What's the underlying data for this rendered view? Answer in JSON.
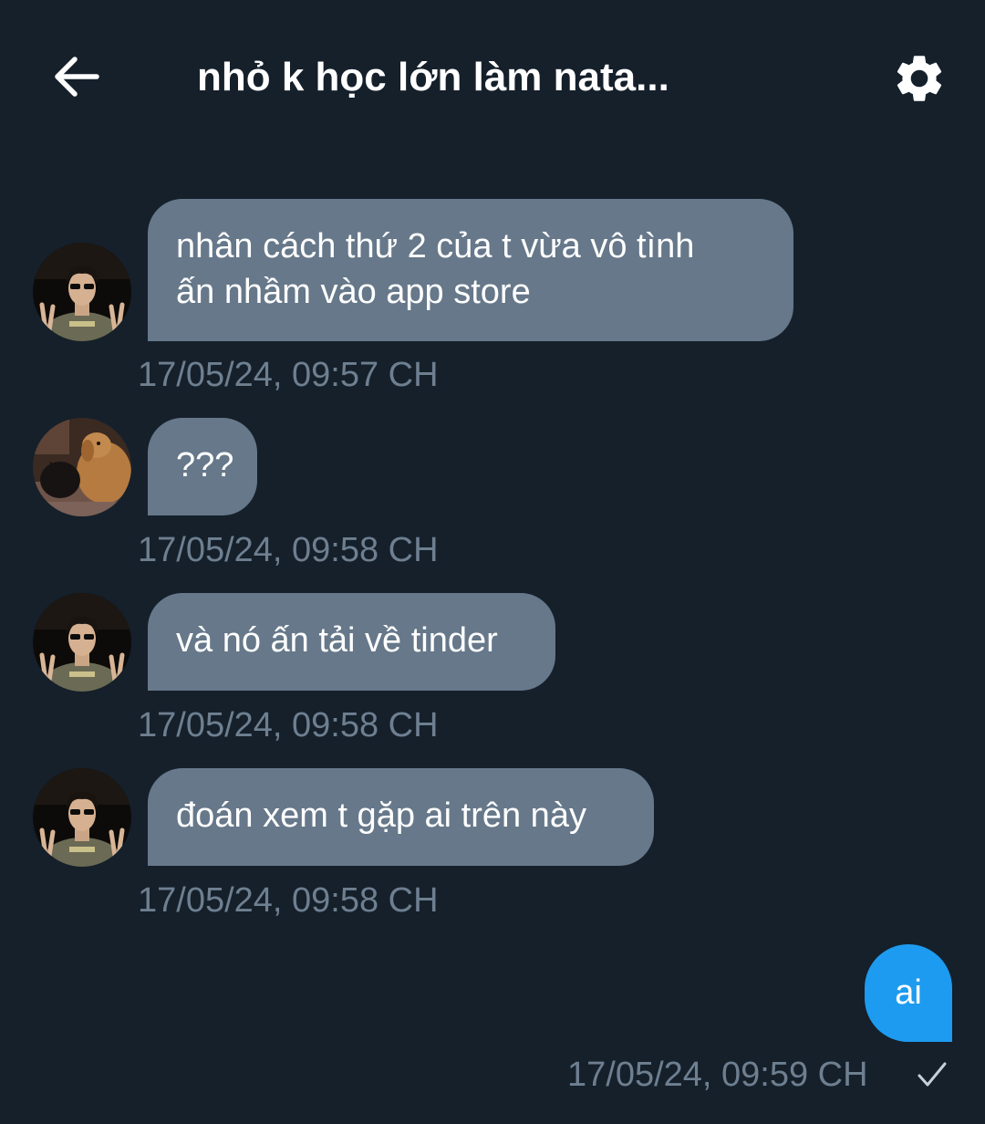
{
  "header": {
    "title": "nhỏ k học lớn làm nata...",
    "back_icon": "arrow-left-icon",
    "settings_icon": "gear-icon"
  },
  "colors": {
    "background": "#15202b",
    "incoming_bubble": "#66788a",
    "outgoing_bubble": "#1d9bf0",
    "timestamp": "#6e7f90"
  },
  "messages": [
    {
      "sender": "them",
      "avatar": "person-sunglasses-avatar",
      "lines": [
        "nhân cách thứ 2 của t vừa vô tình",
        "ấn nhầm vào app store"
      ],
      "timestamp": "17/05/24, 09:57 CH"
    },
    {
      "sender": "them",
      "avatar": "cat-and-dog-avatar",
      "lines": [
        "???"
      ],
      "timestamp": "17/05/24, 09:58 CH"
    },
    {
      "sender": "them",
      "avatar": "person-sunglasses-avatar",
      "lines": [
        "và nó ấn tải về tinder"
      ],
      "timestamp": "17/05/24, 09:58 CH"
    },
    {
      "sender": "them",
      "avatar": "person-sunglasses-avatar",
      "lines": [
        "đoán xem t gặp ai trên này"
      ],
      "timestamp": "17/05/24, 09:58 CH"
    },
    {
      "sender": "me",
      "lines": [
        "ai"
      ],
      "timestamp": "17/05/24, 09:59 CH",
      "status_icon": "checkmark-icon"
    }
  ]
}
